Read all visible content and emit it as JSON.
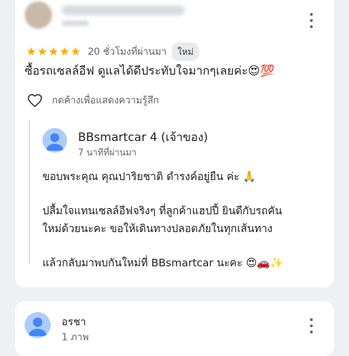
{
  "review": {
    "reviewer_name": "",
    "stars": [
      "★",
      "★",
      "★",
      "★",
      "★"
    ],
    "star_rating": 5,
    "time": "20 ชั่วโมงที่ผ่านมา",
    "new_badge": "ใหม่",
    "text": "ซื้อรถเซลล์อีฟ ดูแลได้ดีประทับใจมากๆเลยค่ะ😍💯",
    "react_label": "กดค้างเพื่อแสดงความรู้สึก",
    "owner_reply": {
      "name": "BBsmartcar 4 (เจ้าของ)",
      "time": "7 นาทีที่ผ่านมา",
      "lines": [
        "ขอบพระคุณ คุณปาริยชาติ ดำรงค์อยู่ยืน ค่ะ 🙏",
        "ปลื้มใจแทนเซลล์อีฟจริงๆ ที่ลูกค้าแฮปปี้ ยินดีกับรถคัน",
        "ใหม่ด้วยนะคะ ขอให้เดินทางปลอดภัยในทุกเส้นทาง",
        "แล้วกลับมาพบกันใหม่ที่ BBsmartcar นะคะ 😍🚗✨"
      ]
    }
  },
  "review2": {
    "name": "อรชา",
    "photos": "1 ภาพ"
  },
  "icons": {
    "star": "star-icon",
    "more": "more-vert-icon",
    "heart": "heart-outline-icon",
    "avatar": "person-icon"
  },
  "colors": {
    "star": "#f9ab00",
    "avatar_bg": "#aecbfa",
    "avatar_fg": "#4285f4",
    "badge_bg": "#e8eaed",
    "secondary_text": "#5f6368"
  }
}
